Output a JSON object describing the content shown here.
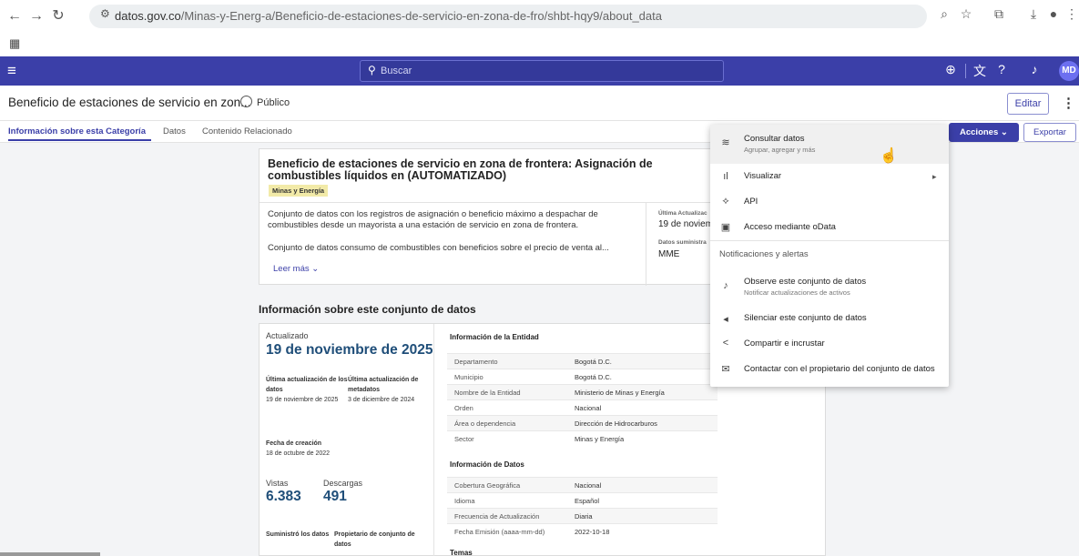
{
  "browser": {
    "url_host": "datos.gov.co",
    "url_path": "/Minas-y-Energ-a/Beneficio-de-estaciones-de-servicio-en-zona-de-fro/shbt-hqy9/about_data"
  },
  "header": {
    "search_placeholder": "Buscar",
    "avatar_initials": "MD"
  },
  "page": {
    "title": "Beneficio de estaciones de servicio en zon...",
    "visibility": "Público",
    "edit_label": "Editar"
  },
  "tabs": [
    {
      "label": "Información sobre esta Categoría",
      "active": true
    },
    {
      "label": "Datos",
      "active": false
    },
    {
      "label": "Contenido Relacionado",
      "active": false
    }
  ],
  "actions": {
    "actions_label": "Acciones",
    "export_label": "Exportar"
  },
  "summary": {
    "title": "Beneficio de estaciones de servicio en zona de frontera: Asignación de combustibles líquidos en (AUTOMATIZADO)",
    "category": "Minas y Energía",
    "description_1": "Conjunto de datos con los registros de asignación o beneficio máximo a despachar de combustibles desde un mayorista a una estación de servicio en zona de frontera.",
    "description_2": "Conjunto de datos consumo de combustibles con beneficios sobre el precio de venta al...",
    "read_more": "Leer más",
    "last_updated_label": "Última Actualizac",
    "last_updated_value": "19 de noviem",
    "provided_by_label": "Datos suministra",
    "provided_by_value": "MME"
  },
  "about": {
    "heading": "Información sobre este conjunto de datos",
    "updated_label": "Actualizado",
    "updated_value": "19 de noviembre de 2025",
    "last_data_update_label": "Última actualización de los datos",
    "last_data_update_value": "19 de noviembre de 2025",
    "last_metadata_update_label": "Última actualización de metadatos",
    "last_metadata_update_value": "3 de diciembre de 2024",
    "created_label": "Fecha de creación",
    "created_value": "18 de octubre de 2022",
    "views_label": "Vistas",
    "views_value": "6.383",
    "downloads_label": "Descargas",
    "downloads_value": "491",
    "provider_label": "Suministró los datos",
    "owner_label": "Propietario de conjunto de datos",
    "entity_title": "Información de la Entidad",
    "entity_rows": [
      {
        "key": "Departamento",
        "value": "Bogotá D.C."
      },
      {
        "key": "Municipio",
        "value": "Bogotá D.C."
      },
      {
        "key": "Nombre de la Entidad",
        "value": "Ministerio de Minas y Energía"
      },
      {
        "key": "Orden",
        "value": "Nacional"
      },
      {
        "key": "Área o dependencia",
        "value": "Dirección de Hidrocarburos"
      },
      {
        "key": "Sector",
        "value": "Minas y Energía"
      }
    ],
    "data_title": "Información de Datos",
    "data_rows": [
      {
        "key": "Cobertura Geográfica",
        "value": "Nacional"
      },
      {
        "key": "Idioma",
        "value": "Español"
      },
      {
        "key": "Frecuencia de Actualización",
        "value": "Diaria"
      },
      {
        "key": "Fecha Emisión (aaaa-mm-dd)",
        "value": "2022-10-18"
      }
    ],
    "topics_title": "Temas"
  },
  "menu": {
    "items": [
      {
        "label": "Consultar datos",
        "sub": "Agrupar, agregar y más",
        "icon": "database-icon"
      },
      {
        "label": "Visualizar",
        "sub": "",
        "icon": "bar-chart-icon"
      },
      {
        "label": "API",
        "sub": "",
        "icon": "api-icon"
      },
      {
        "label": "Acceso mediante oData",
        "sub": "",
        "icon": "odata-icon"
      }
    ],
    "notifications_heading": "Notificaciones y alertas",
    "notification_items": [
      {
        "label": "Observe este conjunto de datos",
        "sub": "Notificar actualizaciones de activos",
        "icon": "bell-icon"
      },
      {
        "label": "Silenciar este conjunto de datos",
        "sub": "",
        "icon": "mute-icon"
      },
      {
        "label": "Compartir e incrustar",
        "sub": "",
        "icon": "share-icon"
      },
      {
        "label": "Contactar con el propietario del conjunto de datos",
        "sub": "",
        "icon": "mail-icon"
      }
    ]
  }
}
